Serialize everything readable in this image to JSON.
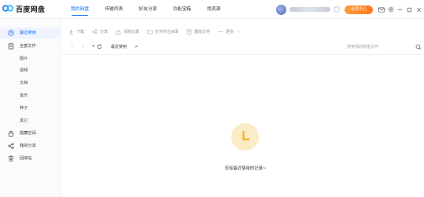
{
  "app": {
    "title": "百度网盘"
  },
  "header": {
    "nav": [
      {
        "label": "我的网盘",
        "active": true
      },
      {
        "label": "传输列表",
        "active": false
      },
      {
        "label": "好友分享",
        "active": false
      },
      {
        "label": "功能宝箱",
        "active": false
      },
      {
        "label": "找资源",
        "active": false
      }
    ],
    "member_button": "会员中心",
    "window_icons": [
      "mail-icon",
      "settings-icon",
      "minimize-icon",
      "maximize-icon",
      "close-icon"
    ]
  },
  "sidebar": {
    "items": [
      {
        "label": "最近使用",
        "icon": "clock-icon",
        "active": true
      },
      {
        "label": "全部文件",
        "icon": "file-icon",
        "active": false
      },
      {
        "label": "图片",
        "sub": true
      },
      {
        "label": "视频",
        "sub": true
      },
      {
        "label": "文档",
        "sub": true
      },
      {
        "label": "音乐",
        "sub": true
      },
      {
        "label": "种子",
        "sub": true
      },
      {
        "label": "其它",
        "sub": true
      },
      {
        "label": "隐藏空间",
        "icon": "lock-icon",
        "active": false
      },
      {
        "label": "我的分享",
        "icon": "share-icon",
        "active": false
      },
      {
        "label": "回收站",
        "icon": "trash-icon",
        "active": false
      }
    ]
  },
  "toolbar": {
    "download": "下载",
    "share": "分享",
    "clear_records": "清除记录",
    "open_folder": "打开所在目录",
    "delete_file": "删除文件",
    "more": "更多"
  },
  "path": {
    "crumb": "最近使用",
    "arrow": ">",
    "search_placeholder": "搜索我的网盘文件"
  },
  "empty": {
    "message": "没有最近使用的记录~"
  },
  "colors": {
    "accent": "#0b6dfb",
    "member": "#ff7a1e",
    "empty_bg": "#fbecc6",
    "empty_fg": "#f2b53f"
  }
}
